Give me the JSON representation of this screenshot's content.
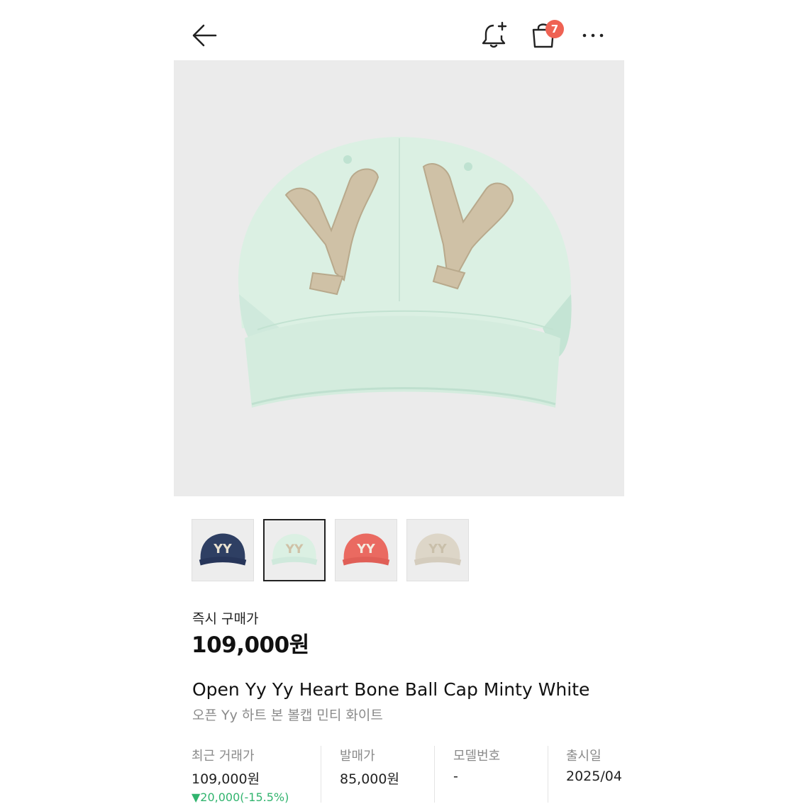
{
  "header": {
    "back_icon": "arrow-left-icon",
    "bell_icon": "bell-plus-icon",
    "bag_icon": "shopping-bag-icon",
    "cart_badge": "7",
    "more_icon": "more-horizontal-icon",
    "badge_color": "#ef6253"
  },
  "gallery": {
    "main_image": "minty-white-cap-photo",
    "thumbnails": [
      {
        "name": "navy-cap-thumbnail",
        "selected": false
      },
      {
        "name": "minty-white-cap-thumbnail",
        "selected": true
      },
      {
        "name": "coral-cap-thumbnail",
        "selected": false
      },
      {
        "name": "beige-cap-thumbnail",
        "selected": false
      }
    ]
  },
  "product": {
    "price_label": "즉시 구매가",
    "price": "109,000원",
    "name_en": "Open Yy Yy Heart Bone Ball Cap Minty White",
    "name_ko": "오픈 Yy 하트 본 볼캡 민티 화이트"
  },
  "stats": [
    {
      "label": "최근 거래가",
      "value": "109,000원",
      "change": "▼20,000(-15.5%)"
    },
    {
      "label": "발매가",
      "value": "85,000원"
    },
    {
      "label": "모델번호",
      "value": "-"
    },
    {
      "label": "출시일",
      "value": "2025/04"
    }
  ],
  "colors": {
    "change_down": "#31b46e",
    "cap_mint": "#d9efe2",
    "logo_beige": "#cfc1a6"
  }
}
